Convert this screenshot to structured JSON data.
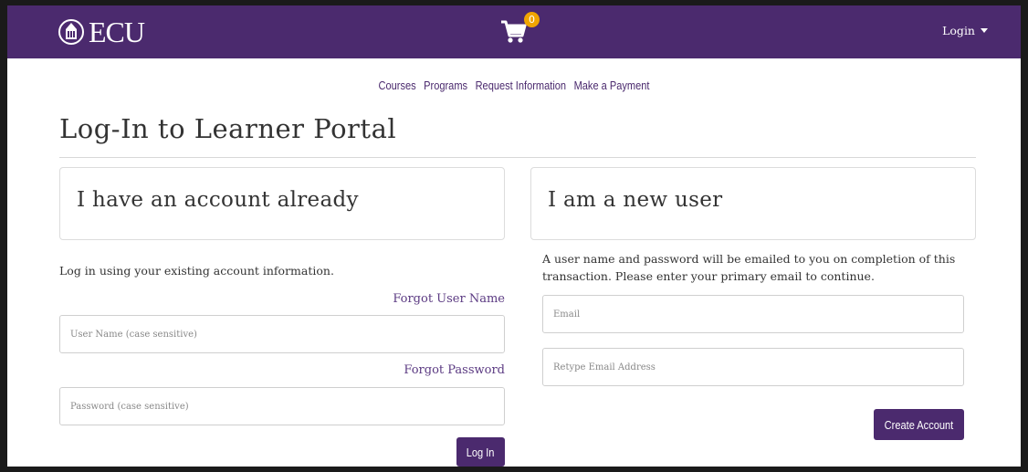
{
  "header": {
    "logo_text": "ECU",
    "cart_count": "0",
    "login_label": "Login",
    "brand_color": "#4b2a6e",
    "badge_color": "#f0a500"
  },
  "nav": {
    "items": [
      "Courses",
      "Programs",
      "Request Information",
      "Make a Payment"
    ]
  },
  "page": {
    "title": "Log-In to Learner Portal"
  },
  "existing": {
    "heading": "I have an account already",
    "intro": "Log in using your existing account information.",
    "forgot_username": "Forgot User Name",
    "username_placeholder": "User Name (case sensitive)",
    "forgot_password": "Forgot Password",
    "password_placeholder": "Password (case sensitive)",
    "login_button": "Log In"
  },
  "new_user": {
    "heading": "I am a new user",
    "intro": "A user name and password will be emailed to you on completion of this transaction. Please enter your primary email to continue.",
    "email_placeholder": "Email",
    "retype_placeholder": "Retype Email Address",
    "create_button": "Create Account"
  }
}
